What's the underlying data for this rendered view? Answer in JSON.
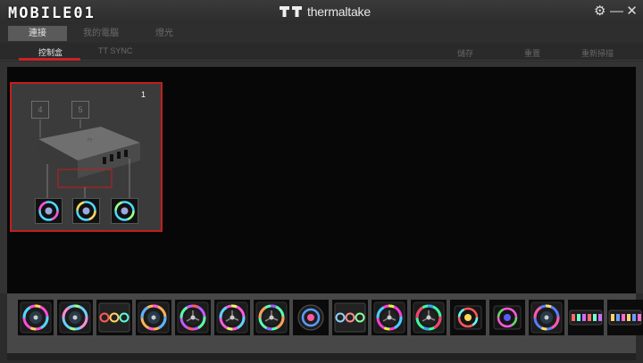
{
  "watermark": {
    "text": "MOBILE01"
  },
  "brand": {
    "name": "thermaltake"
  },
  "window": {
    "settings_glyph": "⚙",
    "minimize_glyph": "—",
    "close_glyph": "✕"
  },
  "tabs": [
    {
      "label": "連接",
      "active": true
    },
    {
      "label": "我的電腦",
      "active": false
    },
    {
      "label": "燈光",
      "active": false
    }
  ],
  "subtabs": [
    {
      "label": "控制盒",
      "active": true
    },
    {
      "label": "TT SYNC",
      "active": false
    }
  ],
  "actions": {
    "save": "儲存",
    "reset": "重置",
    "rescan": "重新掃描"
  },
  "controller": {
    "number": "1",
    "ports": [
      "4",
      "5"
    ],
    "fan_count": 3
  },
  "devices": [
    {
      "type": "ring-fan",
      "colors": [
        "#ff4fd8",
        "#4fd8ff",
        "#ffd54f"
      ]
    },
    {
      "type": "ring-fan",
      "colors": [
        "#6ad1ff",
        "#ff8bd1",
        "#9dff8b"
      ]
    },
    {
      "type": "triple-fan",
      "colors": [
        "#ff5a5a",
        "#ffd65a",
        "#5affd6"
      ]
    },
    {
      "type": "ring-fan",
      "colors": [
        "#ffb35a",
        "#5ab3ff",
        "#ff5ad6"
      ]
    },
    {
      "type": "blade-fan",
      "colors": [
        "#c45aff",
        "#5aff9d",
        "#ff5a5a"
      ]
    },
    {
      "type": "blade-fan",
      "colors": [
        "#ff5ae1",
        "#5ad2ff",
        "#e1ff5a"
      ]
    },
    {
      "type": "blade-fan",
      "colors": [
        "#5affb3",
        "#ff9d5a",
        "#9d5aff"
      ]
    },
    {
      "type": "pump",
      "colors": [
        "#5a9dff",
        "#ff5a9d",
        "#5affd2"
      ]
    },
    {
      "type": "triple-fan",
      "colors": [
        "#8bd1ff",
        "#ff8b8b",
        "#8bff9d"
      ]
    },
    {
      "type": "blade-fan",
      "colors": [
        "#ff3dd5",
        "#3dd5ff",
        "#d5ff3d"
      ]
    },
    {
      "type": "blade-fan",
      "colors": [
        "#3dffa0",
        "#ff3d6d",
        "#3d9dff"
      ]
    },
    {
      "type": "block",
      "colors": [
        "#ff5a5a",
        "#5affff",
        "#ffd65a"
      ]
    },
    {
      "type": "block",
      "colors": [
        "#ff5add",
        "#5add5a",
        "#5a5aff"
      ]
    },
    {
      "type": "ring-fan",
      "colors": [
        "#5a7dff",
        "#ff5aa8",
        "#ffe05a"
      ]
    },
    {
      "type": "strip",
      "colors": [
        "#ff6a6a",
        "#6affd2",
        "#d26aff"
      ]
    },
    {
      "type": "strip",
      "colors": [
        "#ffd26a",
        "#6a9dff",
        "#ff6ad2"
      ]
    }
  ]
}
